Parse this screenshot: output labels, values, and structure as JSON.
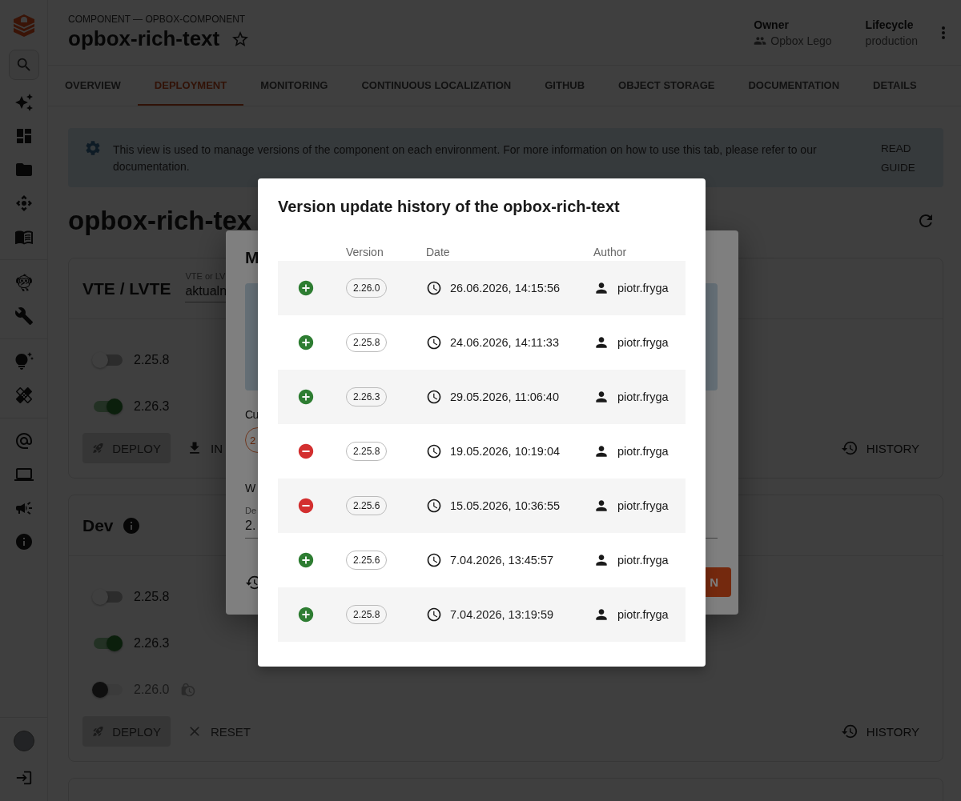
{
  "header": {
    "breadcrumb": "COMPONENT — OPBOX-COMPONENT",
    "title": "opbox-rich-text",
    "favorite": false,
    "owner_label": "Owner",
    "owner": "Opbox Lego",
    "lifecycle_label": "Lifecycle",
    "lifecycle": "production"
  },
  "tabs": [
    {
      "label": "OVERVIEW",
      "selected": false
    },
    {
      "label": "DEPLOYMENT",
      "selected": true
    },
    {
      "label": "MONITORING",
      "selected": false
    },
    {
      "label": "CONTINUOUS LOCALIZATION",
      "selected": false
    },
    {
      "label": "GITHUB",
      "selected": false
    },
    {
      "label": "OBJECT STORAGE",
      "selected": false
    },
    {
      "label": "DOCUMENTATION",
      "selected": false
    },
    {
      "label": "DETAILS",
      "selected": false
    }
  ],
  "alert": {
    "text": "This view is used to manage versions of the component on each environment. For more information on how to use this tab, please refer to our documentation.",
    "action": "READ GUIDE"
  },
  "page_title": "opbox-rich-tex",
  "environments": [
    {
      "name": "VTE / LVTE",
      "info": false,
      "field": {
        "label": "VTE or LV",
        "value": "aktualn"
      },
      "versions": [
        {
          "version": "2.25.8",
          "on": false,
          "disabled": false
        },
        {
          "version": "2.26.3",
          "on": true,
          "disabled": false
        }
      ],
      "actions": [
        {
          "kind": "deploy",
          "label": "DEPLOY"
        },
        {
          "kind": "install",
          "label": "IN"
        }
      ],
      "history": "HISTORY"
    },
    {
      "name": "Dev",
      "info": true,
      "versions": [
        {
          "version": "2.25.8",
          "on": false,
          "disabled": false
        },
        {
          "version": "2.26.3",
          "on": true,
          "disabled": false
        },
        {
          "version": "2.26.0",
          "on": false,
          "disabled": true
        }
      ],
      "actions": [
        {
          "kind": "deploy",
          "label": "DEPLOY"
        },
        {
          "kind": "reset",
          "label": "RESET"
        }
      ],
      "history": "HISTORY"
    }
  ],
  "background_dialog": {
    "title": "M",
    "current_label": "Cu",
    "chip": "2",
    "section_label": "W",
    "field_label": "De",
    "field_value": "2.",
    "button": "N"
  },
  "dialog": {
    "title": "Version update history of the opbox-rich-text",
    "columns": [
      "Version",
      "Date",
      "Author"
    ],
    "rows": [
      {
        "kind": "added",
        "version": "2.26.0",
        "date": "26.06.2026, 14:15:56",
        "author": "piotr.fryga"
      },
      {
        "kind": "added",
        "version": "2.25.8",
        "date": "24.06.2026, 14:11:33",
        "author": "piotr.fryga"
      },
      {
        "kind": "added",
        "version": "2.26.3",
        "date": "29.05.2026, 11:06:40",
        "author": "piotr.fryga"
      },
      {
        "kind": "removed",
        "version": "2.25.8",
        "date": "19.05.2026, 10:19:04",
        "author": "piotr.fryga"
      },
      {
        "kind": "removed",
        "version": "2.25.6",
        "date": "15.05.2026, 10:36:55",
        "author": "piotr.fryga"
      },
      {
        "kind": "added",
        "version": "2.25.6",
        "date": "7.04.2026, 13:45:57",
        "author": "piotr.fryga"
      },
      {
        "kind": "added",
        "version": "2.25.8",
        "date": "7.04.2026, 13:19:59",
        "author": "piotr.fryga"
      }
    ]
  }
}
